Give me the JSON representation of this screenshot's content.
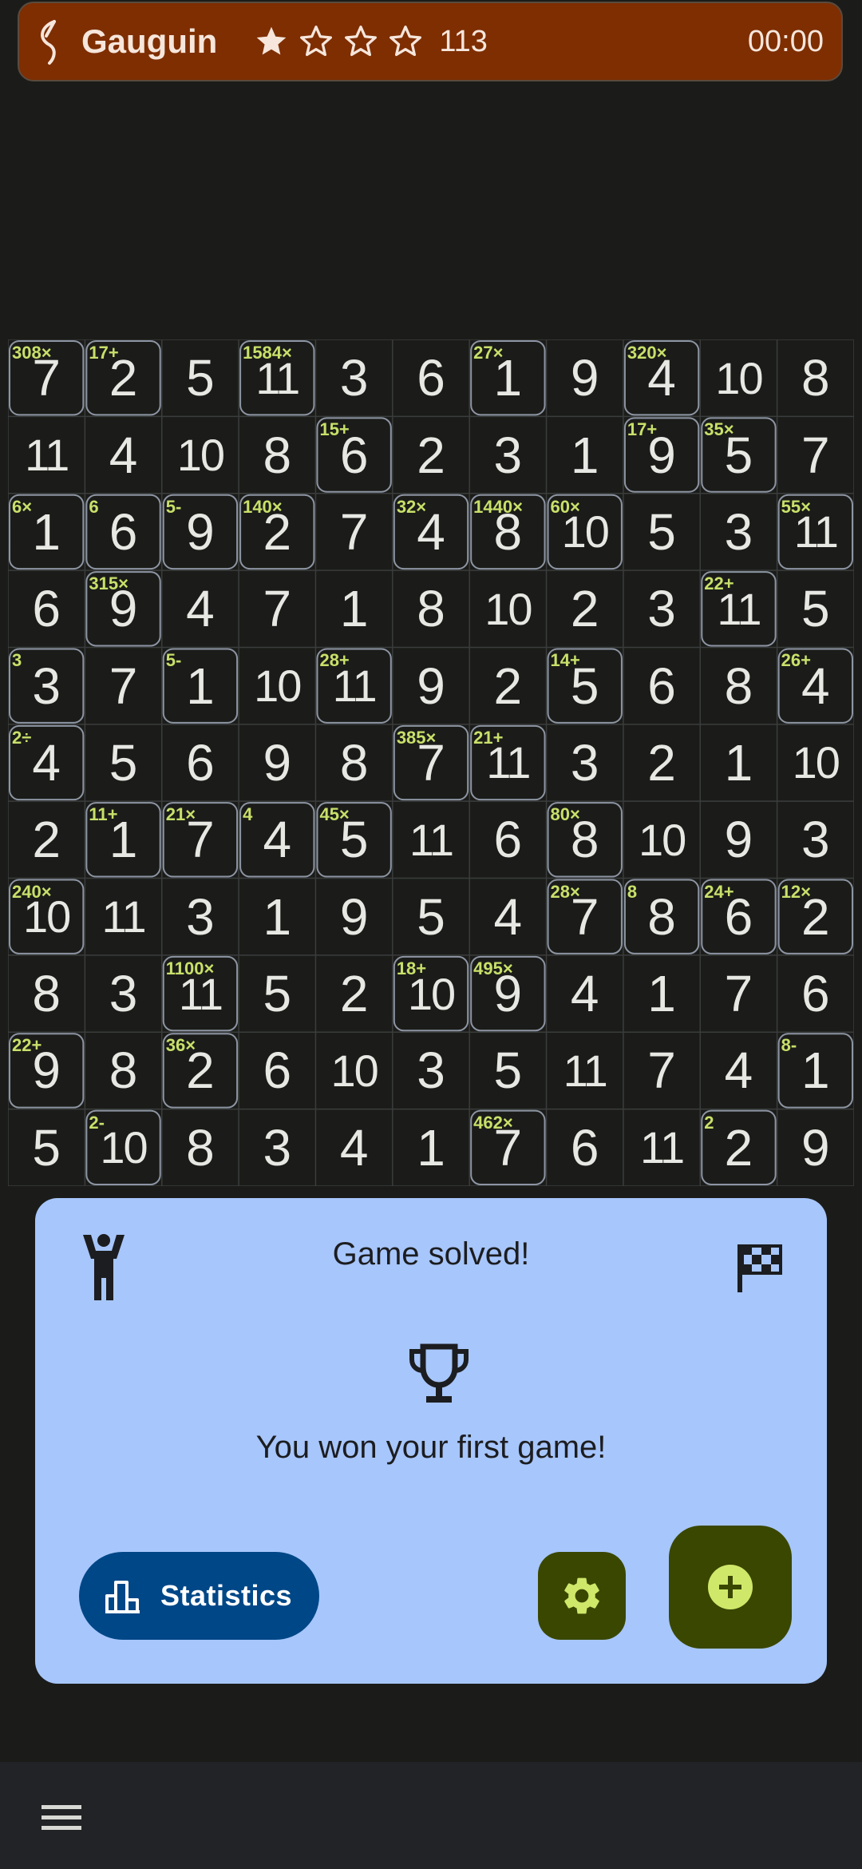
{
  "header": {
    "app_title": "Gauguin",
    "stars_filled": 1,
    "stars_total": 4,
    "score": "113",
    "timer": "00:00",
    "background_color": "#7e2e00"
  },
  "grid": {
    "size": 11,
    "rows": [
      [
        "7",
        "2",
        "5",
        "11",
        "3",
        "6",
        "1",
        "9",
        "4",
        "10",
        "8"
      ],
      [
        "11",
        "4",
        "10",
        "8",
        "6",
        "2",
        "3",
        "1",
        "9",
        "5",
        "7"
      ],
      [
        "1",
        "6",
        "9",
        "2",
        "7",
        "4",
        "8",
        "10",
        "5",
        "3",
        "11"
      ],
      [
        "6",
        "9",
        "4",
        "7",
        "1",
        "8",
        "10",
        "2",
        "3",
        "11",
        "5"
      ],
      [
        "3",
        "7",
        "1",
        "10",
        "11",
        "9",
        "2",
        "5",
        "6",
        "8",
        "4"
      ],
      [
        "4",
        "5",
        "6",
        "9",
        "8",
        "7",
        "11",
        "3",
        "2",
        "1",
        "10"
      ],
      [
        "2",
        "1",
        "7",
        "4",
        "5",
        "11",
        "6",
        "8",
        "10",
        "9",
        "3"
      ],
      [
        "10",
        "11",
        "3",
        "1",
        "9",
        "5",
        "4",
        "7",
        "8",
        "6",
        "2"
      ],
      [
        "8",
        "3",
        "11",
        "5",
        "2",
        "10",
        "9",
        "4",
        "1",
        "7",
        "6"
      ],
      [
        "9",
        "8",
        "2",
        "6",
        "10",
        "3",
        "5",
        "11",
        "7",
        "4",
        "1"
      ],
      [
        "5",
        "10",
        "8",
        "3",
        "4",
        "1",
        "7",
        "6",
        "11",
        "2",
        "9"
      ]
    ],
    "cage_labels": [
      {
        "row": 0,
        "col": 0,
        "text": "308×"
      },
      {
        "row": 0,
        "col": 1,
        "text": "17+"
      },
      {
        "row": 0,
        "col": 3,
        "text": "1584×"
      },
      {
        "row": 0,
        "col": 6,
        "text": "27×"
      },
      {
        "row": 0,
        "col": 8,
        "text": "320×"
      },
      {
        "row": 1,
        "col": 4,
        "text": "15+"
      },
      {
        "row": 1,
        "col": 8,
        "text": "17+"
      },
      {
        "row": 1,
        "col": 9,
        "text": "35×"
      },
      {
        "row": 2,
        "col": 0,
        "text": "6×"
      },
      {
        "row": 2,
        "col": 1,
        "text": "6"
      },
      {
        "row": 2,
        "col": 2,
        "text": "5-"
      },
      {
        "row": 2,
        "col": 3,
        "text": "140×"
      },
      {
        "row": 2,
        "col": 5,
        "text": "32×"
      },
      {
        "row": 2,
        "col": 6,
        "text": "1440×"
      },
      {
        "row": 2,
        "col": 7,
        "text": "60×"
      },
      {
        "row": 2,
        "col": 10,
        "text": "55×"
      },
      {
        "row": 3,
        "col": 1,
        "text": "315×"
      },
      {
        "row": 3,
        "col": 9,
        "text": "22+"
      },
      {
        "row": 4,
        "col": 0,
        "text": "3"
      },
      {
        "row": 4,
        "col": 2,
        "text": "5-"
      },
      {
        "row": 4,
        "col": 4,
        "text": "28+"
      },
      {
        "row": 4,
        "col": 7,
        "text": "14+"
      },
      {
        "row": 4,
        "col": 10,
        "text": "26+"
      },
      {
        "row": 5,
        "col": 0,
        "text": "2÷"
      },
      {
        "row": 5,
        "col": 5,
        "text": "385×"
      },
      {
        "row": 5,
        "col": 6,
        "text": "21+"
      },
      {
        "row": 6,
        "col": 1,
        "text": "11+"
      },
      {
        "row": 6,
        "col": 2,
        "text": "21×"
      },
      {
        "row": 6,
        "col": 3,
        "text": "4"
      },
      {
        "row": 6,
        "col": 4,
        "text": "45×"
      },
      {
        "row": 6,
        "col": 7,
        "text": "80×"
      },
      {
        "row": 7,
        "col": 0,
        "text": "240×"
      },
      {
        "row": 7,
        "col": 7,
        "text": "28×"
      },
      {
        "row": 7,
        "col": 8,
        "text": "8"
      },
      {
        "row": 7,
        "col": 9,
        "text": "24+"
      },
      {
        "row": 7,
        "col": 10,
        "text": "12×"
      },
      {
        "row": 8,
        "col": 2,
        "text": "1100×"
      },
      {
        "row": 8,
        "col": 5,
        "text": "18+"
      },
      {
        "row": 8,
        "col": 6,
        "text": "495×"
      },
      {
        "row": 9,
        "col": 0,
        "text": "22+"
      },
      {
        "row": 9,
        "col": 2,
        "text": "36×"
      },
      {
        "row": 9,
        "col": 10,
        "text": "8-"
      },
      {
        "row": 10,
        "col": 1,
        "text": "2-"
      },
      {
        "row": 10,
        "col": 6,
        "text": "462×"
      },
      {
        "row": 10,
        "col": 9,
        "text": "2"
      }
    ],
    "label_color": "#c8e06a",
    "cage_border_color": "#8d95a3"
  },
  "panel": {
    "title": "Game solved!",
    "message": "You won your first game!",
    "statistics_label": "Statistics",
    "background_color": "#a7c6fb",
    "icons": [
      "person-cheering-icon",
      "checkered-flag-icon",
      "trophy-icon",
      "bar-chart-icon",
      "gear-icon",
      "add-circle-icon"
    ]
  },
  "bottom_bar": {
    "icon": "hamburger-menu-icon"
  }
}
